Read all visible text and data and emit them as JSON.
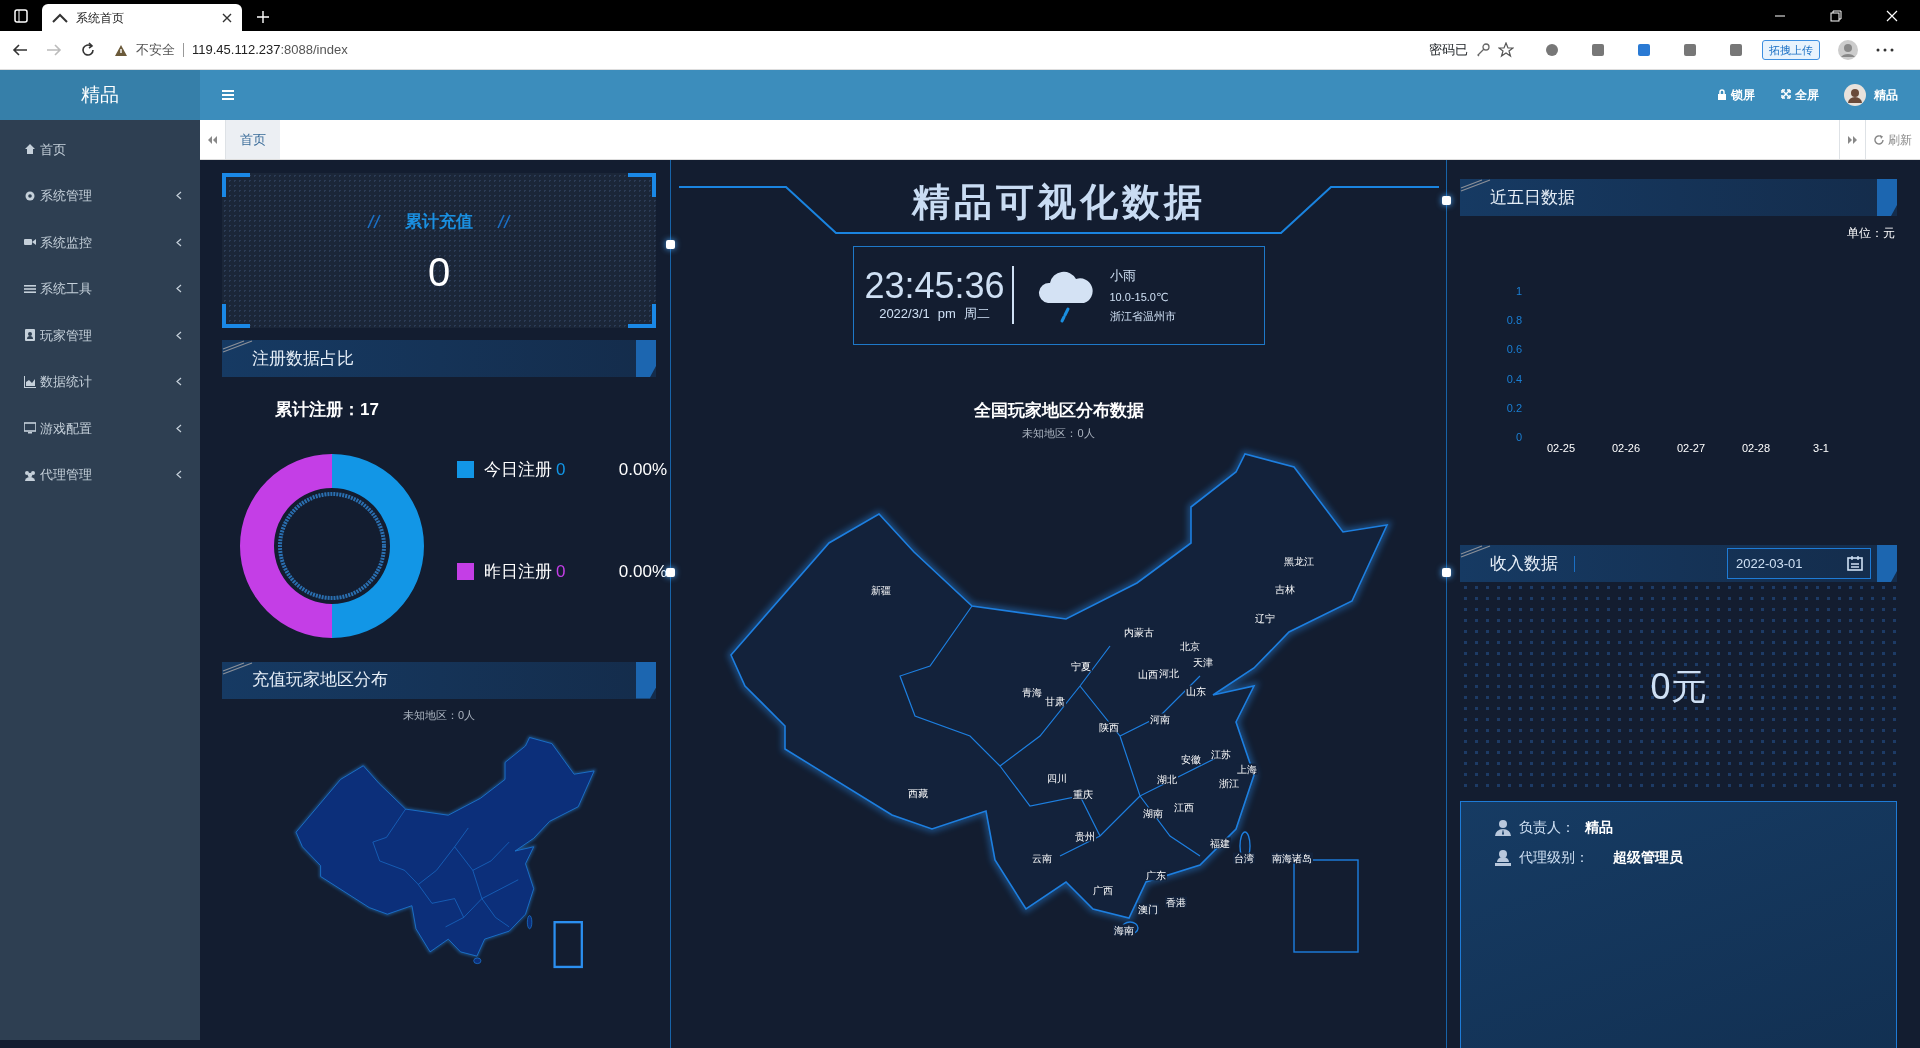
{
  "browser": {
    "tab_title": "系统首页",
    "security": "不安全",
    "url_host": "119.45.112.237",
    "url_rest": ":8088/index",
    "password_note": "密码已",
    "extension_label": "拓拽上传"
  },
  "app": {
    "logo": "精品",
    "header_actions": [
      {
        "label": "锁屏",
        "kind": "lock"
      },
      {
        "label": "全屏",
        "kind": "fullscreen"
      }
    ],
    "user": "精品"
  },
  "sidebar": {
    "items": [
      {
        "label": "首页",
        "kind": "home",
        "expandable": false
      },
      {
        "label": "系统管理",
        "kind": "gear",
        "expandable": true
      },
      {
        "label": "系统监控",
        "kind": "camera",
        "expandable": true
      },
      {
        "label": "系统工具",
        "kind": "bars",
        "expandable": true
      },
      {
        "label": "玩家管理",
        "kind": "contact",
        "expandable": true
      },
      {
        "label": "数据统计",
        "kind": "chart",
        "expandable": true
      },
      {
        "label": "游戏配置",
        "kind": "monitor",
        "expandable": true
      },
      {
        "label": "代理管理",
        "kind": "users",
        "expandable": true
      }
    ]
  },
  "page_tabs": {
    "tabs": [
      {
        "label": "首页",
        "selected": true
      }
    ],
    "refresh": "刷新"
  },
  "recharge_total": {
    "title": "累计充值",
    "value": "0"
  },
  "registration": {
    "title": "注册数据占比",
    "total": "累计注册：17",
    "legend": [
      {
        "label": "今日注册",
        "count": "0",
        "percent": "0.00%",
        "color": "#1296e6"
      },
      {
        "label": "昨日注册",
        "count": "0",
        "percent": "0.00%",
        "color": "#c43ee6"
      }
    ]
  },
  "recharge_map": {
    "title": "充值玩家地区分布",
    "subtitle": "未知地区：0人"
  },
  "banner": {
    "title": "精品可视化数据"
  },
  "clock": {
    "time": "23:45:36",
    "date": "2022/3/1",
    "meridiem": "pm",
    "weekday": "周二"
  },
  "weather": {
    "condition": "小雨",
    "temperature": "10.0-15.0℃",
    "city": "浙江省温州市"
  },
  "player_map": {
    "title": "全国玩家地区分布数据",
    "subtitle": "未知地区：0人",
    "labels": [
      "新疆",
      "黑龙江",
      "吉林",
      "辽宁",
      "内蒙古",
      "北京",
      "天津",
      "宁夏",
      "山西",
      "河北",
      "青海",
      "甘肃",
      "山东",
      "河南",
      "陕西",
      "安徽",
      "江苏",
      "上海",
      "四川",
      "湖北",
      "浙江",
      "重庆",
      "西藏",
      "江西",
      "湖南",
      "贵州",
      "福建",
      "云南",
      "台湾",
      "南海诸岛",
      "广东",
      "广西",
      "香港",
      "澳门",
      "海南"
    ]
  },
  "five_days": {
    "title": "近五日数据",
    "unit": "单位：元",
    "chart_data": {
      "type": "bar",
      "categories": [
        "02-25",
        "02-26",
        "02-27",
        "02-28",
        "3-1"
      ],
      "values": [
        0,
        0,
        0,
        0,
        0
      ],
      "ylim": [
        0,
        1
      ],
      "yticks": [
        0,
        0.2,
        0.4,
        0.6,
        0.8,
        1
      ]
    }
  },
  "income": {
    "title": "收入数据",
    "date": "2022-03-01",
    "amount": "0元"
  },
  "agent": {
    "rows": [
      {
        "label": "负责人：",
        "value": "精品",
        "kind": "person"
      },
      {
        "label": "代理级别：",
        "value": "超级管理员",
        "kind": "level"
      }
    ]
  }
}
